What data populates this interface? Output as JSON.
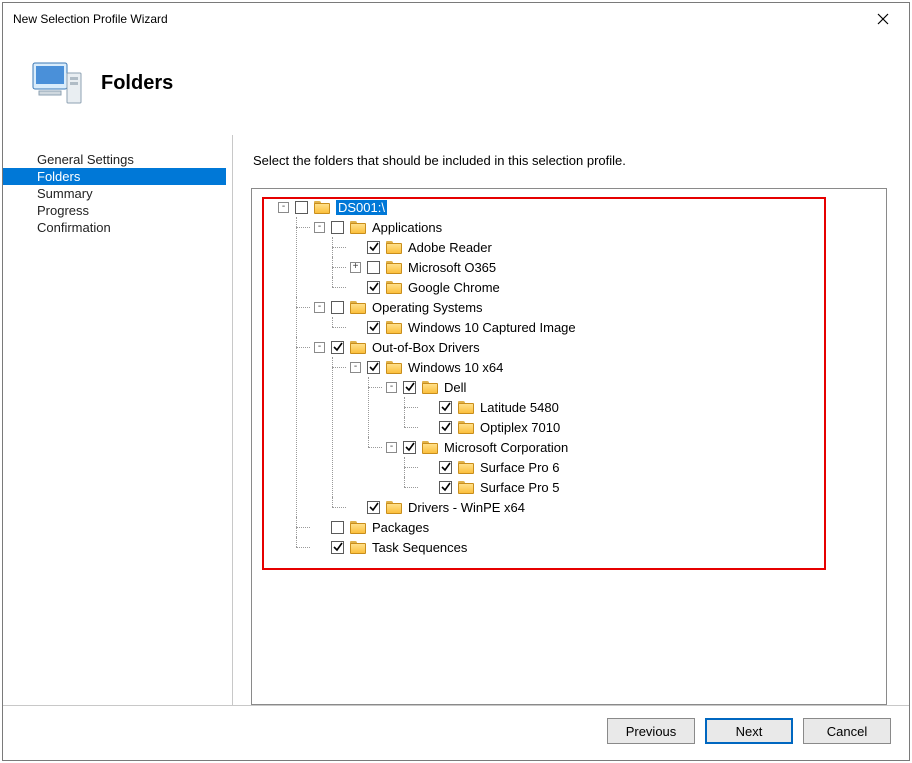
{
  "window": {
    "title": "New Selection Profile Wizard"
  },
  "header": {
    "pageTitle": "Folders"
  },
  "sidebar": {
    "items": [
      {
        "label": "General Settings",
        "selected": false
      },
      {
        "label": "Folders",
        "selected": true
      },
      {
        "label": "Summary",
        "selected": false
      },
      {
        "label": "Progress",
        "selected": false
      },
      {
        "label": "Confirmation",
        "selected": false
      }
    ]
  },
  "content": {
    "instruction": "Select the folders that should be included in this selection profile."
  },
  "tree": {
    "root": {
      "label": "DS001:\\",
      "checked": false,
      "expandedSymbol": "-",
      "selected": true,
      "children": [
        {
          "label": "Applications",
          "checked": false,
          "expandedSymbol": "-",
          "children": [
            {
              "label": "Adobe Reader",
              "checked": true,
              "expandedSymbol": "",
              "children": []
            },
            {
              "label": "Microsoft O365",
              "checked": false,
              "expandedSymbol": "+",
              "children": []
            },
            {
              "label": "Google Chrome",
              "checked": true,
              "expandedSymbol": "",
              "children": []
            }
          ]
        },
        {
          "label": "Operating Systems",
          "checked": false,
          "expandedSymbol": "-",
          "children": [
            {
              "label": "Windows 10 Captured Image",
              "checked": true,
              "expandedSymbol": "",
              "children": []
            }
          ]
        },
        {
          "label": "Out-of-Box Drivers",
          "checked": true,
          "expandedSymbol": "-",
          "children": [
            {
              "label": "Windows 10 x64",
              "checked": true,
              "expandedSymbol": "-",
              "children": [
                {
                  "label": "Dell",
                  "checked": true,
                  "expandedSymbol": "-",
                  "children": [
                    {
                      "label": "Latitude 5480",
                      "checked": true,
                      "expandedSymbol": "",
                      "children": []
                    },
                    {
                      "label": "Optiplex 7010",
                      "checked": true,
                      "expandedSymbol": "",
                      "children": []
                    }
                  ]
                },
                {
                  "label": "Microsoft Corporation",
                  "checked": true,
                  "expandedSymbol": "-",
                  "children": [
                    {
                      "label": "Surface Pro 6",
                      "checked": true,
                      "expandedSymbol": "",
                      "children": []
                    },
                    {
                      "label": "Surface Pro 5",
                      "checked": true,
                      "expandedSymbol": "",
                      "children": []
                    }
                  ]
                }
              ]
            },
            {
              "label": "Drivers - WinPE x64",
              "checked": true,
              "expandedSymbol": "",
              "children": []
            }
          ]
        },
        {
          "label": "Packages",
          "checked": false,
          "expandedSymbol": "",
          "children": []
        },
        {
          "label": "Task Sequences",
          "checked": true,
          "expandedSymbol": "",
          "children": []
        }
      ]
    }
  },
  "footer": {
    "previous": "Previous",
    "next": "Next",
    "cancel": "Cancel"
  }
}
